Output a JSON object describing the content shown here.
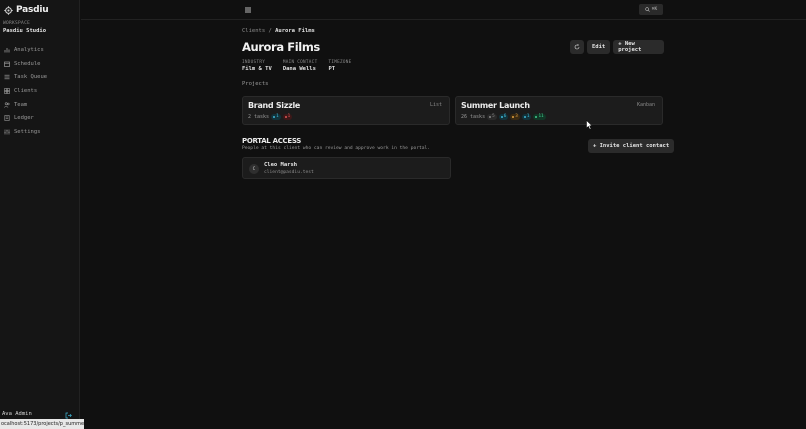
{
  "sidebar": {
    "brand": "Pasdiu",
    "workspace_label": "WORKSPACE",
    "workspace_name": "Pasdiu Studio",
    "items": [
      {
        "label": "Analytics",
        "icon": "bar-chart-icon"
      },
      {
        "label": "Schedule",
        "icon": "calendar-icon"
      },
      {
        "label": "Task Queue",
        "icon": "list-icon"
      },
      {
        "label": "Clients",
        "icon": "grid-icon"
      },
      {
        "label": "Team",
        "icon": "users-icon"
      },
      {
        "label": "Ledger",
        "icon": "ledger-icon"
      },
      {
        "label": "Settings",
        "icon": "sliders-icon"
      }
    ],
    "user_name": "Ava Admin"
  },
  "topbar": {
    "search_shortcut": "⌘K"
  },
  "status_url": "ocalhost:5173/projects/p_summer",
  "breadcrumb": {
    "parent": "Clients",
    "separator": "/",
    "current": "Aurora Films"
  },
  "client": {
    "name": "Aurora Films",
    "meta": [
      {
        "label": "INDUSTRY",
        "value": "Film & TV"
      },
      {
        "label": "MAIN CONTACT",
        "value": "Dana Wells"
      },
      {
        "label": "TIMEZONE",
        "value": "PT"
      }
    ]
  },
  "actions": {
    "edit": "Edit",
    "new_project": "+ New project"
  },
  "projects_title": "Projects",
  "projects": [
    {
      "name": "Brand Sizzle",
      "view": "List",
      "tasks": "2 tasks",
      "pills": [
        {
          "count": "1",
          "color": "#3fb8d8",
          "bg": "#12333b"
        },
        {
          "count": "1",
          "color": "#e05555",
          "bg": "#3d1818"
        }
      ]
    },
    {
      "name": "Summer Launch",
      "view": "Kanban",
      "tasks": "26 tasks",
      "pills": [
        {
          "count": "5",
          "color": "#8a8a8a",
          "bg": "#2a2a2a"
        },
        {
          "count": "6",
          "color": "#3fb8d8",
          "bg": "#12333b"
        },
        {
          "count": "3",
          "color": "#e0a040",
          "bg": "#3a2a12"
        },
        {
          "count": "1",
          "color": "#3fb8d8",
          "bg": "#12333b"
        },
        {
          "count": "11",
          "color": "#3fcf8e",
          "bg": "#123626"
        }
      ]
    }
  ],
  "portal": {
    "title": "PORTAL ACCESS",
    "description": "People at this client who can review and approve work in the portal.",
    "invite_label": "+ Invite client contact",
    "contact": {
      "initial": "C",
      "name": "Cleo Marsh",
      "email": "client@pasdiu.test"
    }
  }
}
